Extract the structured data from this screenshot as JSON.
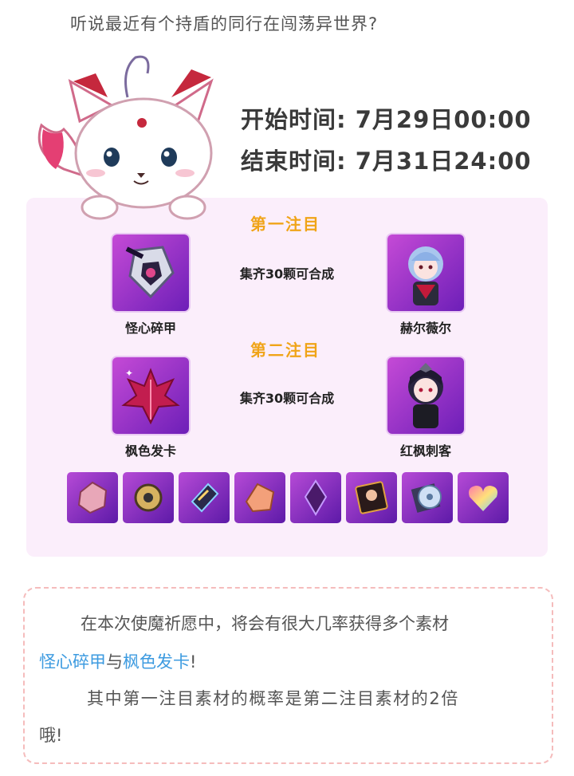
{
  "intro_text": "听说最近有个持盾的同行在闯荡异世界?",
  "times": {
    "start_label": "开始时间:",
    "start_value": "7月29日00:00",
    "end_label": "结束时间:",
    "end_value": "7月31日24:00"
  },
  "section1": {
    "title": "第一注目",
    "item_left": "怪心碎甲",
    "combine_text": "集齐30颗可合成",
    "item_right": "赫尔薇尔"
  },
  "section2": {
    "title": "第二注目",
    "item_left": "枫色发卡",
    "combine_text": "集齐30颗可合成",
    "item_right": "红枫刺客"
  },
  "materials": [
    "pink-gem-icon",
    "mech-part-icon",
    "dark-crystal-icon",
    "orange-crystal-icon",
    "purple-shard-icon",
    "card-pack-icon",
    "disc-icon",
    "rainbow-heart-icon"
  ],
  "notice": {
    "line1": "在本次使魔祈愿中，将会有很大几率获得多个素材",
    "hl1": "怪心碎甲",
    "and": "与",
    "hl2": "枫色发卡",
    "excl": "!",
    "line3": "其中第一注目素材的概率是第二注目素材的2倍",
    "line4": "哦!"
  },
  "colors": {
    "panel": "#fbeefb",
    "title": "#f0a418",
    "highlight": "#3d9be0",
    "border": "#f5bcbc"
  }
}
